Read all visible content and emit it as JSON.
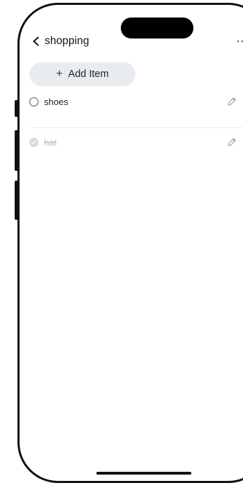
{
  "nav": {
    "title": "shopping"
  },
  "toolbar": {
    "add_plus": "+",
    "add_label": "Add Item"
  },
  "items": [
    {
      "label": "shoes",
      "completed": false
    },
    {
      "label": "hat",
      "completed": true
    }
  ],
  "icons": {
    "back": "chevron-left-icon",
    "more": "more-dots-icon",
    "edit": "pencil-icon",
    "delete": "close-icon",
    "check": "checkbox-circle-icon"
  },
  "colors": {
    "add_button_bg": "#e8ecf1",
    "more_icon": "#3a7bd5",
    "completed_text": "#bdbdbd",
    "frame": "#111111"
  }
}
